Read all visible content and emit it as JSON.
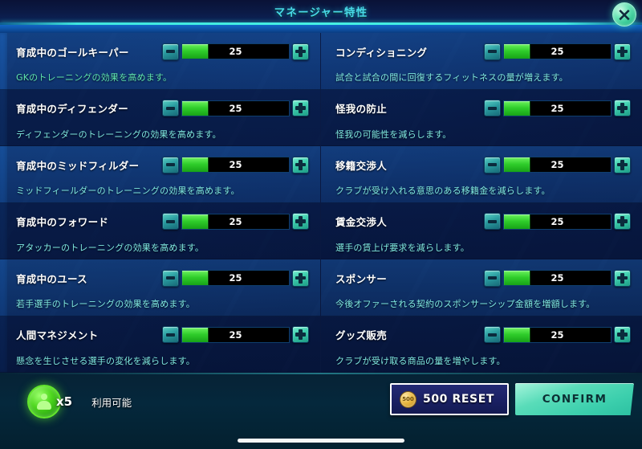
{
  "header": {
    "title": "マネージャー特性",
    "close_icon": "close-x-icon"
  },
  "traits": {
    "left": [
      {
        "title": "育成中のゴールキーパー",
        "desc": "GKのトレーニングの効果を高めます。",
        "value": "25",
        "percent": 25,
        "desc_style": "green"
      },
      {
        "title": "育成中のディフェンダー",
        "desc": "ディフェンダーのトレーニングの効果を高めます。",
        "value": "25",
        "percent": 25,
        "desc_style": "cyan"
      },
      {
        "title": "育成中のミッドフィルダー",
        "desc": "ミッドフィールダーのトレーニングの効果を高めます。",
        "value": "25",
        "percent": 25,
        "desc_style": "cyan"
      },
      {
        "title": "育成中のフォワード",
        "desc": "アタッカーのトレーニングの効果を高めます。",
        "value": "25",
        "percent": 25,
        "desc_style": "cyan"
      },
      {
        "title": "育成中のユース",
        "desc": "若手選手のトレーニングの効果を高めます。",
        "value": "25",
        "percent": 25,
        "desc_style": "cyan"
      },
      {
        "title": "人間マネジメント",
        "desc": "懸念を生じさせる選手の変化を減らします。",
        "value": "25",
        "percent": 25,
        "desc_style": "cyan"
      }
    ],
    "right": [
      {
        "title": "コンディショニング",
        "desc": "試合と試合の間に回復するフィットネスの量が増えます。",
        "value": "25",
        "percent": 25,
        "desc_style": "cyan"
      },
      {
        "title": "怪我の防止",
        "desc": "怪我の可能性を減らします。",
        "value": "25",
        "percent": 25,
        "desc_style": "cyan"
      },
      {
        "title": "移籍交渉人",
        "desc": "クラブが受け入れる意思のある移籍金を減らします。",
        "value": "25",
        "percent": 25,
        "desc_style": "cyan"
      },
      {
        "title": "賃金交渉人",
        "desc": "選手の賃上げ要求を減らします。",
        "value": "25",
        "percent": 25,
        "desc_style": "cyan"
      },
      {
        "title": "スポンサー",
        "desc": "今後オファーされる契約のスポンサーシップ金額を増額します。",
        "value": "25",
        "percent": 25,
        "desc_style": "cyan"
      },
      {
        "title": "グッズ販売",
        "desc": "クラブが受け取る商品の量を増やします。",
        "value": "25",
        "percent": 25,
        "desc_style": "cyan"
      }
    ],
    "stepper": {
      "minus_icon": "minus-icon",
      "plus_icon": "plus-icon"
    }
  },
  "footer": {
    "token_icon": "player-token-icon",
    "token_count": "x5",
    "available_label": "利用可能",
    "reset_button": {
      "label": "500 RESET",
      "coin_icon": "coin-icon",
      "coin_text": "500"
    },
    "confirm_button": {
      "label": "CONFIRM"
    }
  },
  "colors": {
    "accent_cyan": "#49d8e8",
    "bar_green": "#2ecc2a",
    "confirm_mint": "#3ccfad",
    "title_white": "#ffffff",
    "desc_cyan": "#7fe8e0",
    "desc_green": "#5fe6b0"
  }
}
